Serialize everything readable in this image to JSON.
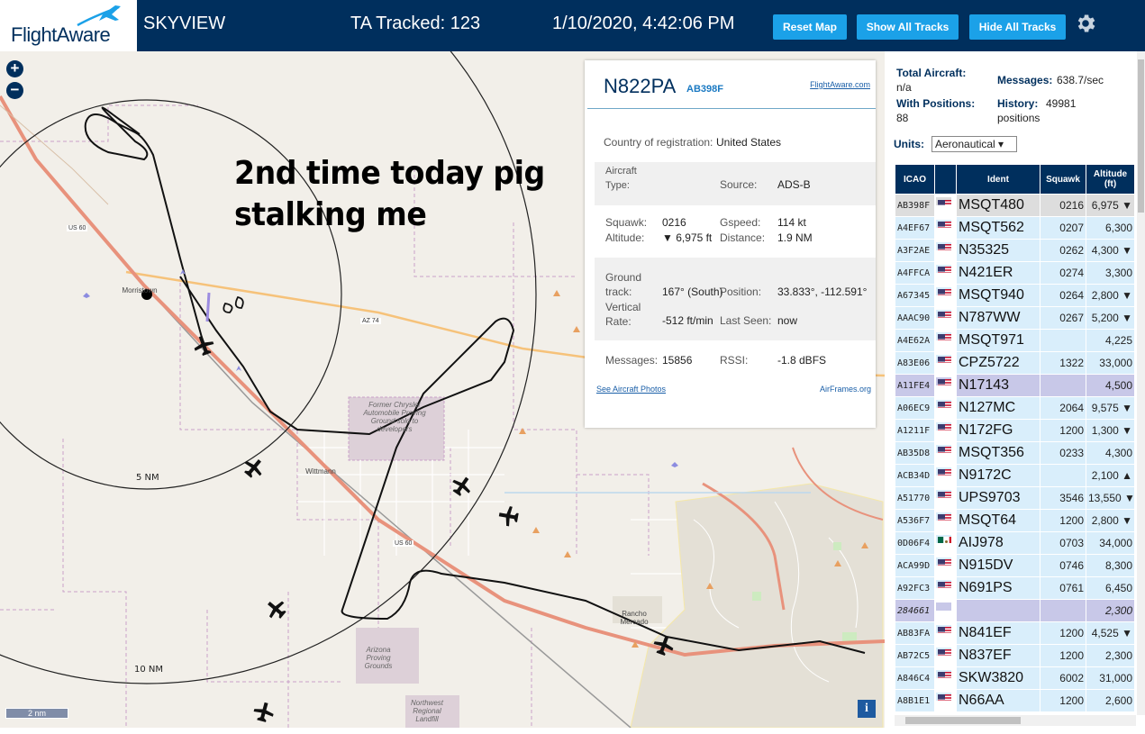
{
  "header": {
    "logo_flight": "Flight",
    "logo_aware": "Aware",
    "app_title": "SKYVIEW",
    "tracked": "TA Tracked: 123",
    "datetime": "1/10/2020, 4:42:06 PM",
    "btn_reset": "Reset Map",
    "btn_show": "Show All Tracks",
    "btn_hide": "Hide All Tracks",
    "settings_icon": "gear-icon"
  },
  "map": {
    "zoom_in": "+",
    "zoom_out": "−",
    "annotation_line1": "2nd time today pig",
    "annotation_line2": "stalking me",
    "ring_5nm": "5 NM",
    "ring_10nm": "10 NM",
    "scale": "2 nm",
    "info": "i",
    "labels": {
      "chrysler": "Former Chrysler Automobile Proving Ground sold to developers",
      "wittmann": "Wittmann",
      "morristown": "Morristown",
      "arizona_pg": "Arizona Proving Grounds",
      "rancho": "Rancho Mercado",
      "landfill": "Northwest Regional Landfill",
      "us60a": "US 60",
      "us60b": "US 60",
      "az74": "AZ 74"
    }
  },
  "detail": {
    "callsign": "N822PA",
    "hex": "AB398F",
    "fa_link": "FlightAware.com",
    "country_label": "Country of registration:",
    "country_value": "United States",
    "type_label": "Aircraft Type:",
    "source_label": "Source:",
    "source_value": "ADS-B",
    "squawk_label": "Squawk:",
    "squawk_value": "0216",
    "gspeed_label": "Gspeed:",
    "gspeed_value": "114 kt",
    "altitude_label": "Altitude:",
    "altitude_value": "▼ 6,975 ft",
    "distance_label": "Distance:",
    "distance_value": "1.9 NM",
    "track_label": "Ground track:",
    "track_value": "167° (South)",
    "position_label": "Position:",
    "position_value": "33.833°, -112.591°",
    "vrate_label": "Vertical Rate:",
    "vrate_value": "-512 ft/min",
    "lastseen_label": "Last Seen:",
    "lastseen_value": "now",
    "messages_label": "Messages:",
    "messages_value": "15856",
    "rssi_label": "RSSI:",
    "rssi_value": "-1.8 dBFS",
    "photos_link": "See Aircraft Photos",
    "airframes_link": "AirFrames.org"
  },
  "sidebar": {
    "total_label": "Total Aircraft:",
    "total_value": "n/a",
    "messages_label": "Messages:",
    "messages_value": "638.7/sec",
    "withpos_label": "With Positions:",
    "withpos_value": "88",
    "history_label": "History:",
    "history_value": "49981",
    "history_unit": "positions",
    "units_label": "Units:",
    "units_value": "Aeronautical ▾",
    "columns": {
      "icao": "ICAO",
      "ident": "Ident",
      "squawk": "Squawk",
      "altitude": "Altitude (ft)"
    },
    "rows": [
      {
        "icao": "AB398F",
        "flag": "us",
        "ident": "MSQT480",
        "squawk": "0216",
        "alt": "6,975 ▼"
      },
      {
        "icao": "A4EF67",
        "flag": "us",
        "ident": "MSQT562",
        "squawk": "0207",
        "alt": "6,300"
      },
      {
        "icao": "A3F2AE",
        "flag": "us",
        "ident": "N35325",
        "squawk": "0262",
        "alt": "4,300 ▼"
      },
      {
        "icao": "A4FFCA",
        "flag": "us",
        "ident": "N421ER",
        "squawk": "0274",
        "alt": "3,300"
      },
      {
        "icao": "A67345",
        "flag": "us",
        "ident": "MSQT940",
        "squawk": "0264",
        "alt": "2,800 ▼"
      },
      {
        "icao": "AAAC90",
        "flag": "us",
        "ident": "N787WW",
        "squawk": "0267",
        "alt": "5,200 ▼"
      },
      {
        "icao": "A4E62A",
        "flag": "us",
        "ident": "MSQT971",
        "squawk": "",
        "alt": "4,225"
      },
      {
        "icao": "A83E06",
        "flag": "us",
        "ident": "CPZ5722",
        "squawk": "1322",
        "alt": "33,000"
      },
      {
        "icao": "A11FE4",
        "flag": "us",
        "ident": "N17143",
        "squawk": "",
        "alt": "4,500"
      },
      {
        "icao": "A06EC9",
        "flag": "us",
        "ident": "N127MC",
        "squawk": "2064",
        "alt": "9,575 ▼"
      },
      {
        "icao": "A1211F",
        "flag": "us",
        "ident": "N172FG",
        "squawk": "1200",
        "alt": "1,300 ▼"
      },
      {
        "icao": "AB35D8",
        "flag": "us",
        "ident": "MSQT356",
        "squawk": "0233",
        "alt": "4,300"
      },
      {
        "icao": "ACB34D",
        "flag": "us",
        "ident": "N9172C",
        "squawk": "",
        "alt": "2,100 ▲"
      },
      {
        "icao": "A51770",
        "flag": "us",
        "ident": "UPS9703",
        "squawk": "3546",
        "alt": "13,550 ▼"
      },
      {
        "icao": "A536F7",
        "flag": "us",
        "ident": "MSQT64",
        "squawk": "1200",
        "alt": "2,800 ▼"
      },
      {
        "icao": "0D06F4",
        "flag": "mx",
        "ident": "AIJ978",
        "squawk": "0703",
        "alt": "34,000"
      },
      {
        "icao": "ACA99D",
        "flag": "us",
        "ident": "N915DV",
        "squawk": "0746",
        "alt": "8,300"
      },
      {
        "icao": "A92FC3",
        "flag": "us",
        "ident": "N691PS",
        "squawk": "0761",
        "alt": "6,450"
      },
      {
        "icao": "284661",
        "flag": "",
        "ident": "",
        "squawk": "",
        "alt": "2,300"
      },
      {
        "icao": "AB83FA",
        "flag": "us",
        "ident": "N841EF",
        "squawk": "1200",
        "alt": "4,525 ▼"
      },
      {
        "icao": "AB72C5",
        "flag": "us",
        "ident": "N837EF",
        "squawk": "1200",
        "alt": "2,300"
      },
      {
        "icao": "A846C4",
        "flag": "us",
        "ident": "SKW3820",
        "squawk": "6002",
        "alt": "31,000"
      },
      {
        "icao": "A8B1E1",
        "flag": "us",
        "ident": "N66AA",
        "squawk": "1200",
        "alt": "2,600"
      }
    ]
  },
  "colors": {
    "header_bg": "#002f5d",
    "button_bg": "#1ba1e8",
    "row_bg": "#d9eefb",
    "selected_row_bg": "#c8c8e8"
  }
}
